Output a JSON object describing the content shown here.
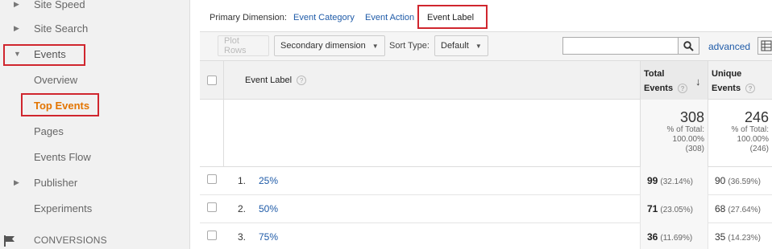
{
  "sidebar": {
    "items": [
      {
        "label": "Site Speed"
      },
      {
        "label": "Site Search"
      },
      {
        "label": "Events"
      },
      {
        "label": "Overview"
      },
      {
        "label": "Top Events"
      },
      {
        "label": "Pages"
      },
      {
        "label": "Events Flow"
      },
      {
        "label": "Publisher"
      },
      {
        "label": "Experiments"
      },
      {
        "label": "CONVERSIONS"
      }
    ]
  },
  "dimensions": {
    "label": "Primary Dimension:",
    "options": [
      "Event Category",
      "Event Action",
      "Event Label"
    ],
    "active": "Event Label"
  },
  "toolbar": {
    "plot_rows": "Plot Rows",
    "secondary_dimension": "Secondary dimension",
    "sort_type_label": "Sort Type:",
    "sort_type_value": "Default",
    "search_value": "",
    "advanced": "advanced"
  },
  "table": {
    "header": {
      "dimension": "Event Label",
      "total_events_l1": "Total",
      "total_events_l2": "Events",
      "unique_events_l1": "Unique",
      "unique_events_l2": "Events"
    },
    "totals": {
      "total_events": "308",
      "total_pct_label": "% of Total:",
      "total_pct": "100.00%",
      "total_abs": "(308)",
      "unique_events": "246",
      "unique_pct_label": "% of Total:",
      "unique_pct": "100.00%",
      "unique_abs": "(246)"
    },
    "rows": [
      {
        "num": "1.",
        "label": "25%",
        "total": "99",
        "total_pct": "(32.14%)",
        "unique": "90",
        "unique_pct": "(36.59%)"
      },
      {
        "num": "2.",
        "label": "50%",
        "total": "71",
        "total_pct": "(23.05%)",
        "unique": "68",
        "unique_pct": "(27.64%)"
      },
      {
        "num": "3.",
        "label": "75%",
        "total": "36",
        "total_pct": "(11.69%)",
        "unique": "35",
        "unique_pct": "(14.23%)"
      }
    ]
  },
  "colors": {
    "accent": "#e37400",
    "link": "#1f5ba8",
    "highlight_box": "#d0262e"
  }
}
